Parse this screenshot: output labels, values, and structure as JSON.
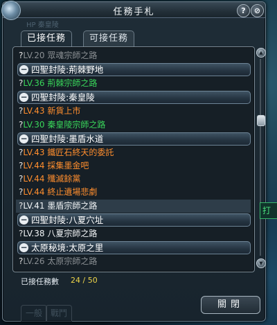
{
  "window": {
    "title": "任務手札",
    "help_button": "?",
    "close_button": "⊘",
    "ghost_text": "HP    秦皇陵"
  },
  "tabs": [
    {
      "label": "已接任務",
      "active": true
    },
    {
      "label": "可接任務",
      "active": false
    }
  ],
  "rows": [
    {
      "kind": "quest",
      "level": "LV.20",
      "name": "眾魂宗師之路",
      "color": "gray"
    },
    {
      "kind": "category",
      "icon": "minus-icon",
      "label": "四聖封陵:荊棘野地"
    },
    {
      "kind": "quest",
      "level": "LV.36",
      "name": "荊棘宗師之路",
      "color": "green"
    },
    {
      "kind": "category",
      "icon": "minus-icon",
      "label": "四聖封陵:秦皇陵"
    },
    {
      "kind": "quest",
      "level": "LV.43",
      "name": "新貨上市",
      "color": "orange"
    },
    {
      "kind": "quest",
      "level": "LV.30",
      "name": "秦皇陵宗師之路",
      "color": "green"
    },
    {
      "kind": "category",
      "icon": "minus-icon",
      "label": "四聖封陵:墨盾水道"
    },
    {
      "kind": "quest",
      "level": "LV.43",
      "name": "鐵匠石終天的委託",
      "color": "orange"
    },
    {
      "kind": "quest",
      "level": "LV.44",
      "name": "採集墨金吧",
      "color": "orange"
    },
    {
      "kind": "quest",
      "level": "LV.44",
      "name": "殲滅餘黨",
      "color": "orange"
    },
    {
      "kind": "quest",
      "level": "LV.44",
      "name": "終止遺場悲劇",
      "color": "orange"
    },
    {
      "kind": "quest",
      "level": "LV.41",
      "name": "墨盾宗師之路",
      "color": "white",
      "selected": true
    },
    {
      "kind": "category",
      "icon": "minus-icon",
      "label": "四聖封陵:八夏穴址"
    },
    {
      "kind": "quest",
      "level": "LV.38",
      "name": "八夏宗師之路",
      "color": "white"
    },
    {
      "kind": "category",
      "icon": "minus-icon",
      "label": "太原秘境:太原之里"
    },
    {
      "kind": "quest",
      "level": "LV.26",
      "name": "太原宗師之路",
      "color": "gray"
    }
  ],
  "quest_marker": "?",
  "scrollbar": {
    "up_icon": "▲",
    "down_icon": "▼",
    "thumb_position": 0.3
  },
  "footer": {
    "accepted_label": "已接任務數",
    "accepted_value": "24 / 50",
    "close_label": "關閉"
  },
  "bottom_tabs": [
    "一般",
    "戰鬥"
  ],
  "side_label": "打"
}
